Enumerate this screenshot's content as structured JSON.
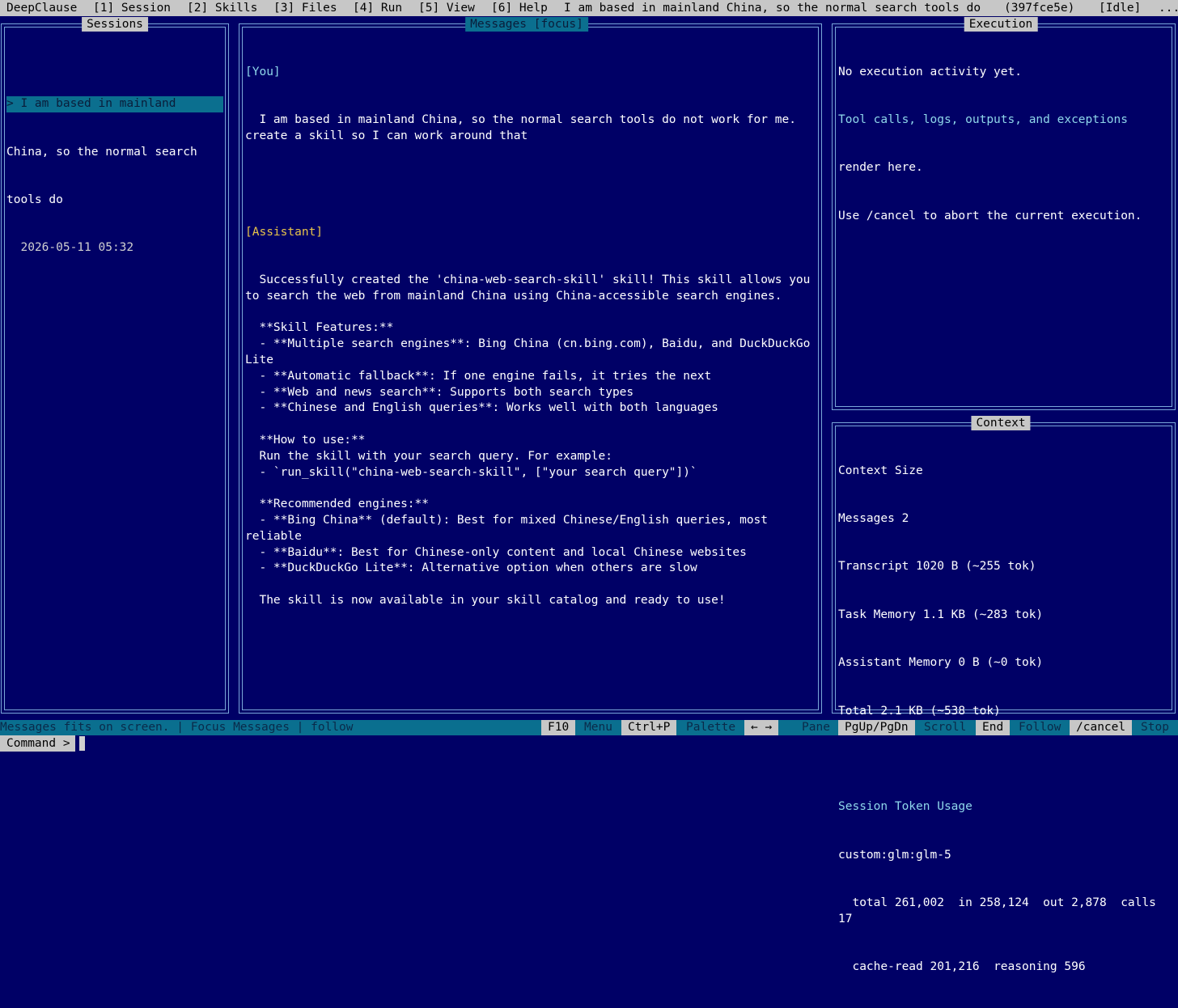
{
  "menubar": {
    "app": "DeepClause",
    "items": [
      "[1] Session",
      "[2] Skills",
      "[3] Files",
      "[4] Run",
      "[5] View",
      "[6] Help"
    ],
    "session_title": "I am based in mainland China, so the normal search tools do",
    "session_id": "(397fce5e)",
    "state": "[Idle]",
    "more": "..."
  },
  "sessions": {
    "title": "Sessions",
    "item_line1": "> I am based in mainland",
    "item_line2": "China, so the normal search",
    "item_line3": "tools do",
    "item_date": "  2026-05-11 05:32"
  },
  "messages": {
    "title": "Messages [focus]",
    "you_label": "[You]",
    "you_text": "  I am based in mainland China, so the normal search tools do not work for me. create a skill so I can work around that",
    "assistant_label": "[Assistant]",
    "lines": [
      "  Successfully created the 'china-web-search-skill' skill! This skill allows you to search the web from mainland China using China-accessible search engines.",
      "",
      "  **Skill Features:**",
      "  - **Multiple search engines**: Bing China (cn.bing.com), Baidu, and DuckDuckGo Lite",
      "  - **Automatic fallback**: If one engine fails, it tries the next",
      "  - **Web and news search**: Supports both search types",
      "  - **Chinese and English queries**: Works well with both languages",
      "",
      "  **How to use:**",
      "  Run the skill with your search query. For example:",
      "  - `run_skill(\"china-web-search-skill\", [\"your search query\"])`",
      "",
      "  **Recommended engines:**",
      "  - **Bing China** (default): Best for mixed Chinese/English queries, most reliable",
      "  - **Baidu**: Best for Chinese-only content and local Chinese websites",
      "  - **DuckDuckGo Lite**: Alternative option when others are slow",
      "",
      "  The skill is now available in your skill catalog and ready to use!"
    ]
  },
  "execution": {
    "title": "Execution",
    "line1": "No execution activity yet.",
    "line2": "Tool calls, logs, outputs, and exceptions",
    "line3": "render here.",
    "line4": "Use /cancel to abort the current execution."
  },
  "context": {
    "title": "Context",
    "heading": "Context Size",
    "messages": "Messages 2",
    "transcript": "Transcript 1020 B (~255 tok)",
    "task_memory": "Task Memory 1.1 KB (~283 tok)",
    "assistant_memory": "Assistant Memory 0 B (~0 tok)",
    "total": "Total 2.1 KB (~538 tok)",
    "usage_heading": "Session Token Usage",
    "model": "custom:glm:glm-5",
    "usage_line1": "  total 261,002  in 258,124  out 2,878  calls 17",
    "usage_line2": "  cache-read 201,216  reasoning 596"
  },
  "status": {
    "text": "Messages fits on screen. | Focus Messages | follow",
    "keys": [
      {
        "key": "F10",
        "action": "Menu"
      },
      {
        "key": "Ctrl+P",
        "action": "Palette"
      },
      {
        "key": "← →",
        "action": "Pane"
      },
      {
        "key": "PgUp/PgDn",
        "action": "Scroll"
      },
      {
        "key": "End",
        "action": "Follow"
      },
      {
        "key": "/cancel",
        "action": "Stop"
      }
    ]
  },
  "command": {
    "label": "Command >",
    "value": ""
  },
  "colors": {
    "background": "#000066",
    "border": "#7aa7d8",
    "bar": "#c7c7c7",
    "accent_cyan": "#8fd7ea",
    "assistant_yellow": "#e8c44a",
    "status_bar": "#0a6f8f"
  }
}
